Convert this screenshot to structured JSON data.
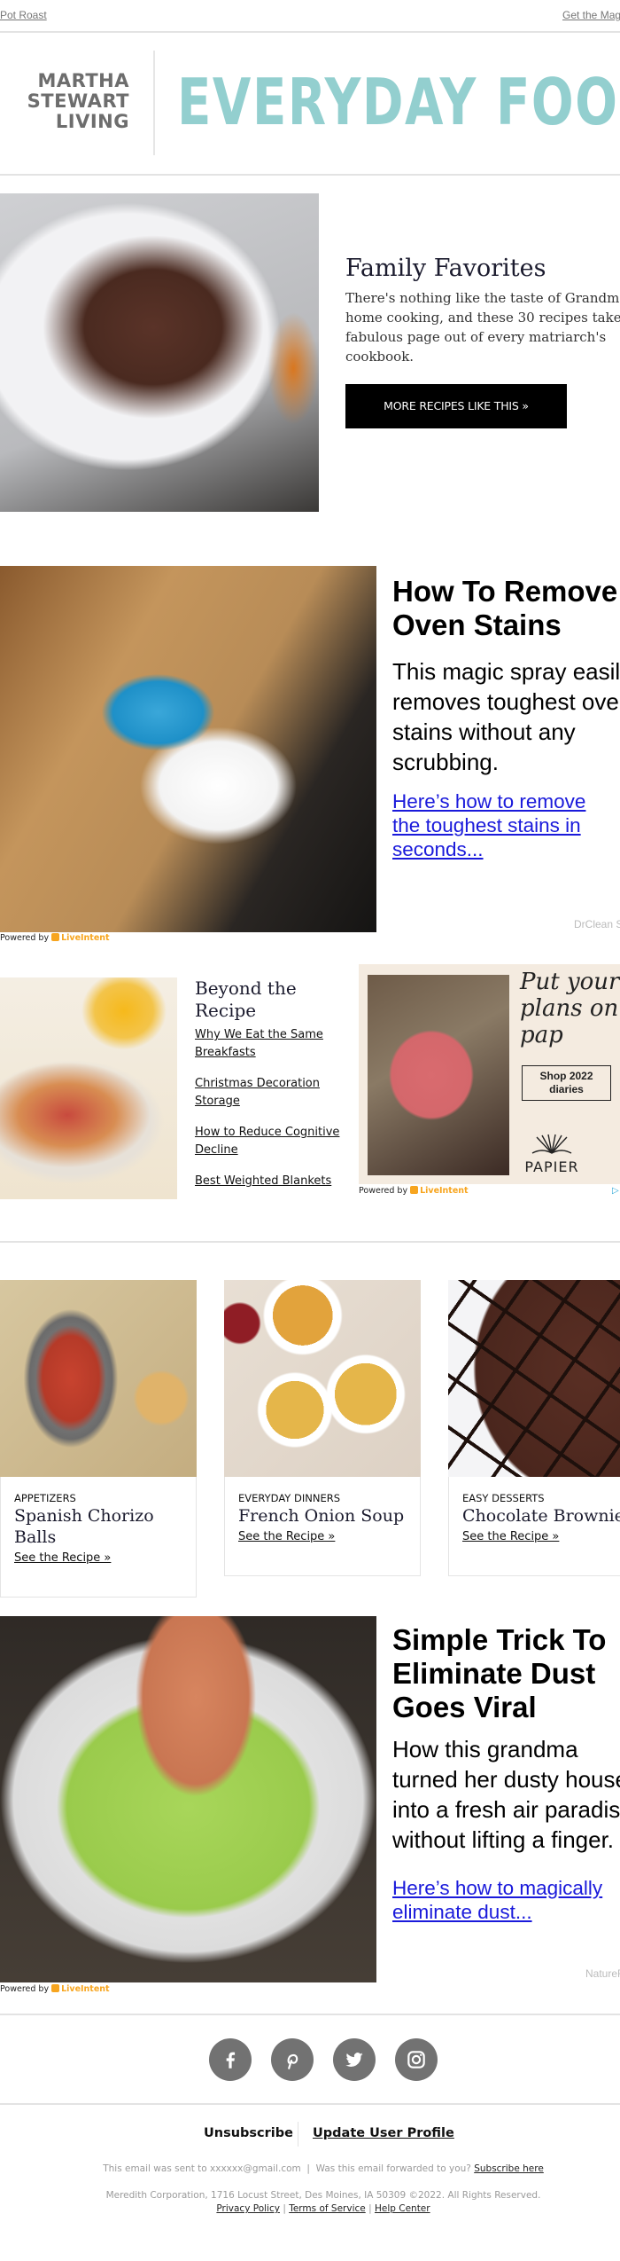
{
  "preheader": {
    "left_link": "Pot Roast",
    "right_link": "Get the Mag"
  },
  "masthead": {
    "brand_lines": [
      "MARTHA",
      "STEWART",
      "LIVING"
    ],
    "publication": "EVERYDAY FOOD",
    "brand_color": "#93cfcf"
  },
  "hero": {
    "image_alt": "Pot roast on white platter",
    "title": "Family Favorites",
    "body": "There's nothing like the taste of Grandma's home cooking, and these 30 recipes take a fabulous page out of every matriarch's cookbook.",
    "button": "MORE RECIPES LIKE THIS »"
  },
  "ad_oven": {
    "image_alt": "Gloved hand cleaning oven tray",
    "title": "How To Remove Oven Stains",
    "body": "This magic spray easily removes toughest oven stains without any scrubbing.",
    "link": "Here’s how to remove the toughest stains in seconds...",
    "sponsor": "DrClean S",
    "powered_by": "Powered by",
    "powered_brand": "LiveIntent"
  },
  "beyond": {
    "image_alt": "Cereal bowl with strawberries",
    "title": "Beyond the Recipe",
    "links": [
      "Why We Eat the Same Breakfasts",
      "Christmas Decoration Storage",
      "How to Reduce Cognitive Decline",
      "Best Weighted Blankets"
    ]
  },
  "ad_papier": {
    "headline": "Put your plans on pap",
    "button": "Shop 2022 diaries",
    "logo": "PAPIER",
    "powered_by": "Powered by",
    "powered_brand": "LiveIntent"
  },
  "cards": [
    {
      "category": "APPETIZERS",
      "title": "Spanish Chorizo Balls",
      "link": "See the Recipe »"
    },
    {
      "category": "EVERYDAY DINNERS",
      "title": "French Onion Soup",
      "link": "See the Recipe »"
    },
    {
      "category": "EASY DESSERTS",
      "title": "Chocolate Brownies",
      "link": "See the Recipe »"
    }
  ],
  "ad_dust": {
    "image_alt": "Finger in bowl of green liquid",
    "title": "Simple Trick To Eliminate Dust Goes Viral",
    "body": "How this grandma turned her dusty house into a fresh air paradise without lifting a finger.",
    "link": "Here’s how to magically eliminate dust...",
    "sponsor": "NatureF",
    "powered_by": "Powered by",
    "powered_brand": "LiveIntent"
  },
  "social": [
    {
      "name": "facebook-icon"
    },
    {
      "name": "pinterest-icon"
    },
    {
      "name": "twitter-icon"
    },
    {
      "name": "instagram-icon"
    }
  ],
  "footer": {
    "unsubscribe": "Unsubscribe",
    "update_profile": "Update User Profile",
    "sent_to": "This email was sent to xxxxxx@gmail.com  |  Was this email forwarded to you?",
    "subscribe_here": "Subscribe here",
    "address": "Meredith Corporation, 1716 Locust Street, Des Moines, IA 50309 ©2022. All Rights Reserved.",
    "privacy": "Privacy Policy",
    "terms": "Terms of Service",
    "help": "Help Center",
    "sep": "|"
  }
}
